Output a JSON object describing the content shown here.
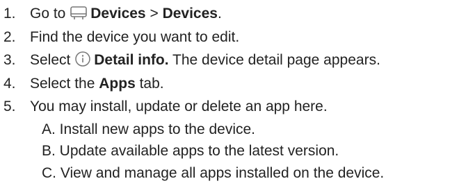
{
  "steps": [
    {
      "number": "1.",
      "prefix": "Go to",
      "icon": "devices-icon",
      "bold1": "Devices",
      "separator": ">",
      "bold2": "Devices",
      "suffix": "."
    },
    {
      "number": "2.",
      "text": "Find the device you want to edit."
    },
    {
      "number": "3.",
      "prefix": "Select",
      "icon": "info-icon",
      "bold": "Detail info.",
      "suffix": "The device detail page appears."
    },
    {
      "number": "4.",
      "prefix": "Select the",
      "bold": "Apps",
      "suffix": "tab."
    },
    {
      "number": "5.",
      "text": "You may install, update or delete an app here.",
      "substeps": [
        {
          "text": "A. Install new apps to the device."
        },
        {
          "text": "B. Update available apps to the latest version."
        },
        {
          "text": "C. View and manage all apps installed on the device."
        }
      ]
    }
  ],
  "colors": {
    "text": "#222222",
    "icon": "#777777"
  }
}
